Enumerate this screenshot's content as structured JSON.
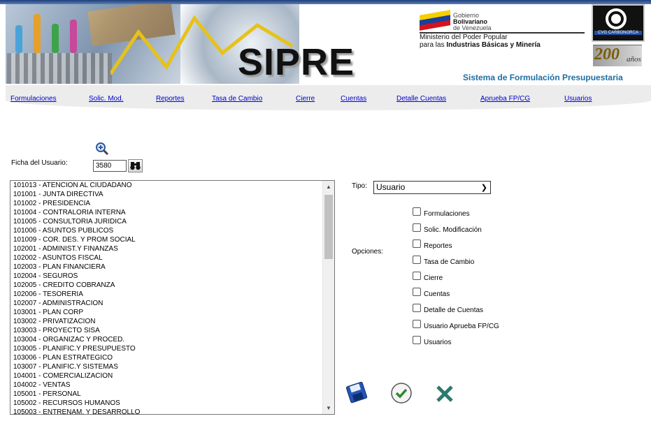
{
  "banner": {
    "title": "SIPRE",
    "subtitle": "Sistema de Formulación Presupuestaria",
    "gov_line1": "Gobierno",
    "gov_line2": "Bolivariano",
    "gov_line3": "de Venezuela",
    "ministry_line1": "Ministerio del Poder Popular",
    "ministry_line2_prefix": "para las ",
    "ministry_line2_bold": "Industrias Básicas y Minería",
    "cvg_logo_text": "CVG CARBONORCA",
    "anniversary_number": "200",
    "anniversary_word": "años"
  },
  "nav": [
    "Formulaciones",
    "Solic. Mod.",
    "Reportes",
    "Tasa de Cambio",
    "Cierre",
    "Cuentas",
    "Detalle Cuentas",
    "Aprueba FP/CG",
    "Usuarios"
  ],
  "form": {
    "ficha_label": "Ficha del Usuario:",
    "ficha_value": "3580",
    "tipo_label": "Tipo:",
    "tipo_value": "Usuario",
    "opciones_label": "Opciones:"
  },
  "units": [
    "101013 - ATENCION AL CIUDADANO",
    "101001 - JUNTA DIRECTIVA",
    "101002 - PRESIDENCIA",
    "101004 - CONTRALORIA INTERNA",
    "101005 - CONSULTORIA JURIDICA",
    "101006 - ASUNTOS PUBLICOS",
    "101009 - COR. DES. Y PROM SOCIAL",
    "102001 - ADMINIST.Y FINANZAS",
    "102002 - ASUNTOS FISCAL",
    "102003 - PLAN FINANCIERA",
    "102004 - SEGUROS",
    "102005 - CREDITO COBRANZA",
    "102006 - TESORERIA",
    "102007 - ADMINISTRACION",
    "103001 - PLAN CORP",
    "103002 - PRIVATIZACION",
    "103003 - PROYECTO SISA",
    "103004 - ORGANIZAC Y PROCED.",
    "103005 - PLANIFIC.Y PRESUPUESTO",
    "103006 - PLAN ESTRATEGICO",
    "103007 - PLANIFIC.Y SISTEMAS",
    "104001 - COMERCIALIZACION",
    "104002 - VENTAS",
    "105001 - PERSONAL",
    "105002 - RECURSOS HUMANOS",
    "105003 - ENTRENAM. Y DESARROLLO"
  ],
  "options": [
    "Formulaciones",
    "Solic. Modificación",
    "Reportes",
    "Tasa de Cambio",
    "Cierre",
    "Cuentas",
    "Detalle de Cuentas",
    "Usuario Aprueba FP/CG",
    "Usuarios"
  ],
  "icons": {
    "zoom": "zoom-in-icon",
    "search": "binoculars-icon",
    "save": "floppy-disk-icon",
    "accept": "check-icon",
    "cancel": "cancel-x-icon"
  },
  "colors": {
    "link": "#0000cc",
    "subtitle": "#1d6fa5",
    "nav_bg": "#ececec"
  }
}
